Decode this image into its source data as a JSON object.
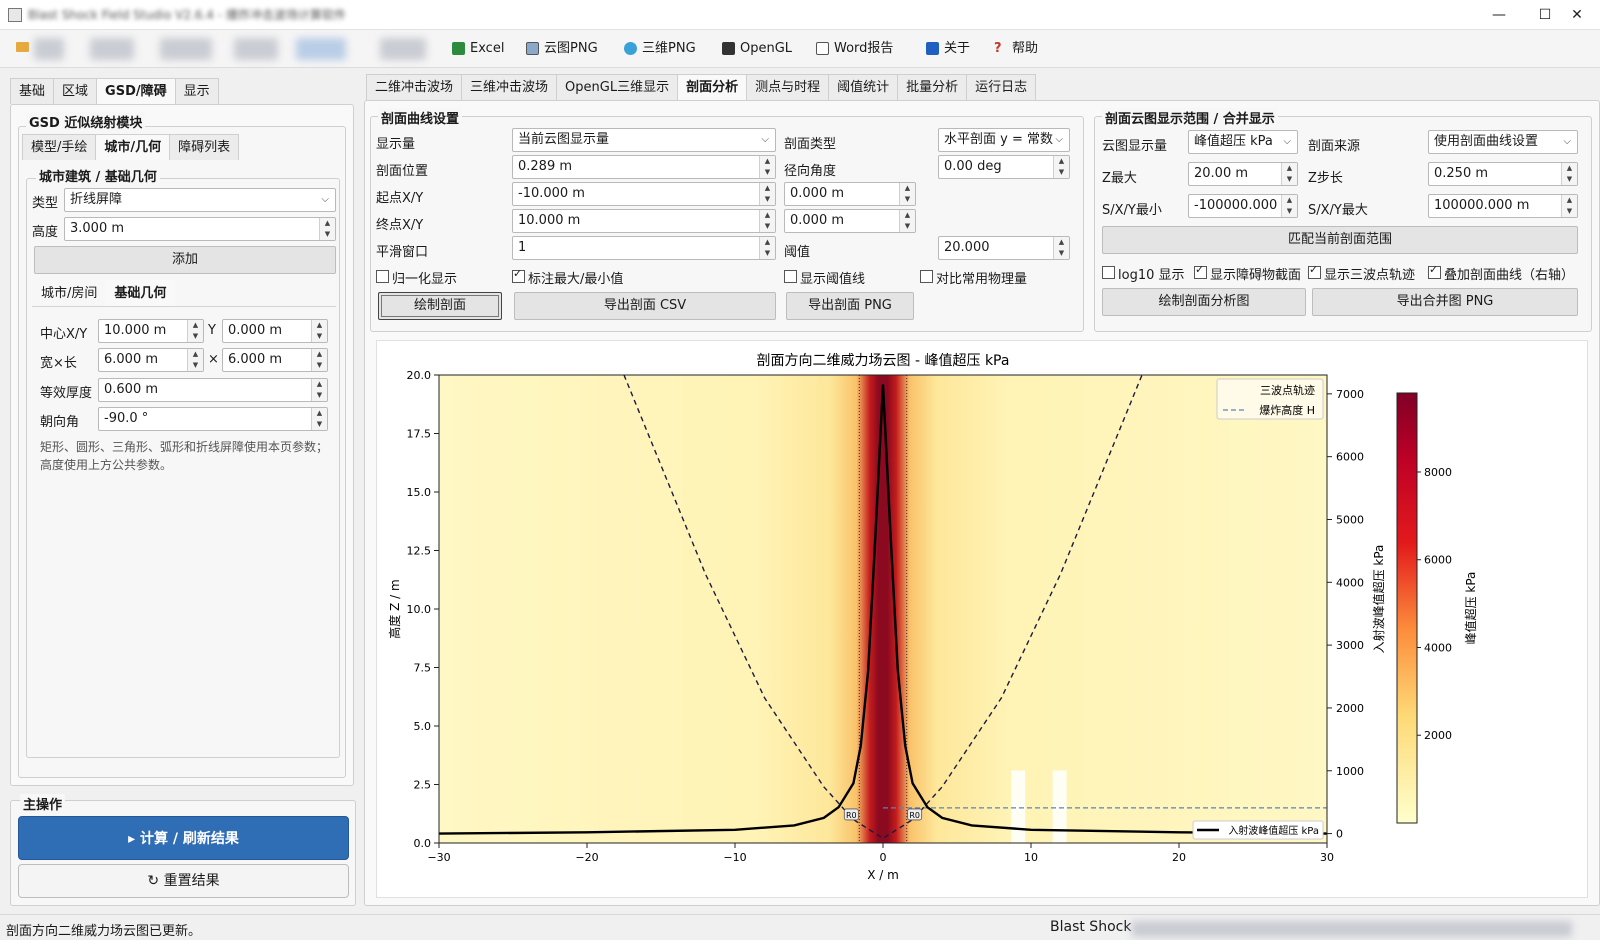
{
  "window": {
    "title": "Blast Shock Field Studio V2.6.4 - 爆炸冲击波场计算软件",
    "min": "—",
    "max": "☐",
    "close": "✕"
  },
  "toolbar": {
    "excel": "Excel",
    "cloud_png": "云图PNG",
    "three_d_png": "三维PNG",
    "opengl": "OpenGL",
    "word": "Word报告",
    "about": "关于",
    "help": "帮助"
  },
  "left": {
    "tabs": [
      "基础",
      "区域",
      "GSD/障碍",
      "显示"
    ],
    "gsd_title": "GSD 近似绕射模块",
    "sub_tabs": [
      "模型/手绘",
      "城市/几何",
      "障碍列表"
    ],
    "city_group_title": "城市建筑 / 基础几何",
    "type_label": "类型",
    "type_value": "折线屏障",
    "height_label": "高度",
    "height_value": "3.000 m",
    "add_button": "添加",
    "inner_tabs": [
      "城市/房间",
      "基础几何"
    ],
    "center_label": "中心X/Y",
    "center_x": "10.000 m",
    "y_sep": "Y",
    "center_y": "0.000 m",
    "size_label": "宽×长",
    "width": "6.000 m",
    "x_sep": "×",
    "length": "6.000 m",
    "thickness_label": "等效厚度",
    "thickness": "0.600 m",
    "orient_label": "朝向角",
    "orient": "-90.0 °",
    "note": "矩形、圆形、三角形、弧形和折线屏障使用本页参数；高度使用上方公共参数。",
    "main_ops_title": "主操作",
    "compute_button": "▸  计算 / 刷新结果",
    "reset_button": "↻  重置结果"
  },
  "right": {
    "tabs": [
      "二维冲击波场",
      "三维冲击波场",
      "OpenGL三维显示",
      "剖面分析",
      "测点与时程",
      "阈值统计",
      "批量分析",
      "运行日志"
    ],
    "curve_group_title": "剖面曲线设置",
    "display_label": "显示量",
    "display_value": "当前云图显示量",
    "prof_type_label": "剖面类型",
    "prof_type_value": "水平剖面 y = 常数",
    "pos_label": "剖面位置",
    "pos_value": "0.289 m",
    "radial_label": "径向角度",
    "radial_value": "0.00 deg",
    "start_label": "起点X/Y",
    "start_x": "-10.000 m",
    "start_y": "0.000 m",
    "end_label": "终点X/Y",
    "end_x": "10.000 m",
    "end_y": "0.000 m",
    "smooth_label": "平滑窗口",
    "smooth_value": "1",
    "thresh_label": "阈值",
    "thresh_value": "20.000",
    "cb_normalize": "归一化显示",
    "cb_minmax": "标注最大/最小值",
    "cb_threshline": "显示阈值线",
    "cb_compare": "对比常用物理量",
    "btn_draw": "绘制剖面",
    "btn_csv": "导出剖面 CSV",
    "btn_png": "导出剖面 PNG",
    "range_group_title": "剖面云图显示范围 / 合并显示",
    "cloud_qty_label": "云图显示量",
    "cloud_qty_value": "峰值超压 kPa",
    "source_label": "剖面来源",
    "source_value": "使用剖面曲线设置",
    "zmax_label": "Z最大",
    "zmax_value": "20.00 m",
    "zstep_label": "Z步长",
    "zstep_value": "0.250 m",
    "smin_label": "S/X/Y最小",
    "smin_value": "-100000.000 m",
    "smax_label": "S/X/Y最大",
    "smax_value": "100000.000 m",
    "btn_match": "匹配当前剖面范围",
    "cb_log10": "log10 显示",
    "cb_obstacle": "显示障碍物截面",
    "cb_triple": "显示三波点轨迹",
    "cb_overlay": "叠加剖面曲线（右轴）",
    "btn_draw_analysis": "绘制剖面分析图",
    "btn_export_merged": "导出合并图 PNG"
  },
  "chart_data": {
    "type": "heatmap",
    "title": "剖面方向二维威力场云图 - 峰值超压  kPa",
    "xlabel": "X / m",
    "ylabel": "高度 Z / m",
    "y2label": "入射波峰值超压 kPa",
    "cbar_label": "峰值超压 kPa",
    "xlim": [
      -30,
      30
    ],
    "ylim": [
      0,
      20
    ],
    "y2lim": [
      -150,
      7300
    ],
    "cbar_lim": [
      0,
      9800
    ],
    "xticks": [
      -30,
      -20,
      -10,
      0,
      10,
      20,
      30
    ],
    "yticks": [
      0.0,
      2.5,
      5.0,
      7.5,
      10.0,
      12.5,
      15.0,
      17.5,
      20.0
    ],
    "y2ticks": [
      0,
      1000,
      2000,
      3000,
      4000,
      5000,
      6000,
      7000
    ],
    "cbar_ticks": [
      2000,
      4000,
      6000,
      8000
    ],
    "legend": {
      "placement": "top-right",
      "entries": [
        "三波点轨迹",
        "爆炸高度 H"
      ]
    },
    "legend2": {
      "placement": "bottom-right",
      "entries": [
        "入射波峰值超压 kPa"
      ]
    },
    "burst_height": 1.5,
    "triple_point_track": {
      "x": [
        -17.5,
        -12,
        -8,
        -4,
        -2,
        0,
        2,
        4,
        8,
        12,
        17.5
      ],
      "y": [
        20,
        11.5,
        6.2,
        2.4,
        1.0,
        0.2,
        1.0,
        2.4,
        6.2,
        11.5,
        20
      ]
    },
    "overpressure_curve": {
      "x": [
        -30,
        -20,
        -10,
        -6,
        -4,
        -3,
        -2,
        -1.5,
        -1,
        -0.5,
        0,
        0.5,
        1,
        1.5,
        2,
        3,
        4,
        6,
        10,
        20,
        30
      ],
      "y": [
        0,
        20,
        60,
        130,
        250,
        420,
        800,
        1400,
        2600,
        4800,
        7150,
        4800,
        2600,
        1400,
        800,
        420,
        250,
        130,
        60,
        20,
        0
      ]
    },
    "markers": [
      "R0",
      "R0"
    ]
  },
  "status": {
    "left": "剖面方向二维威力场云图已更新。",
    "right": "Blast Shock"
  }
}
